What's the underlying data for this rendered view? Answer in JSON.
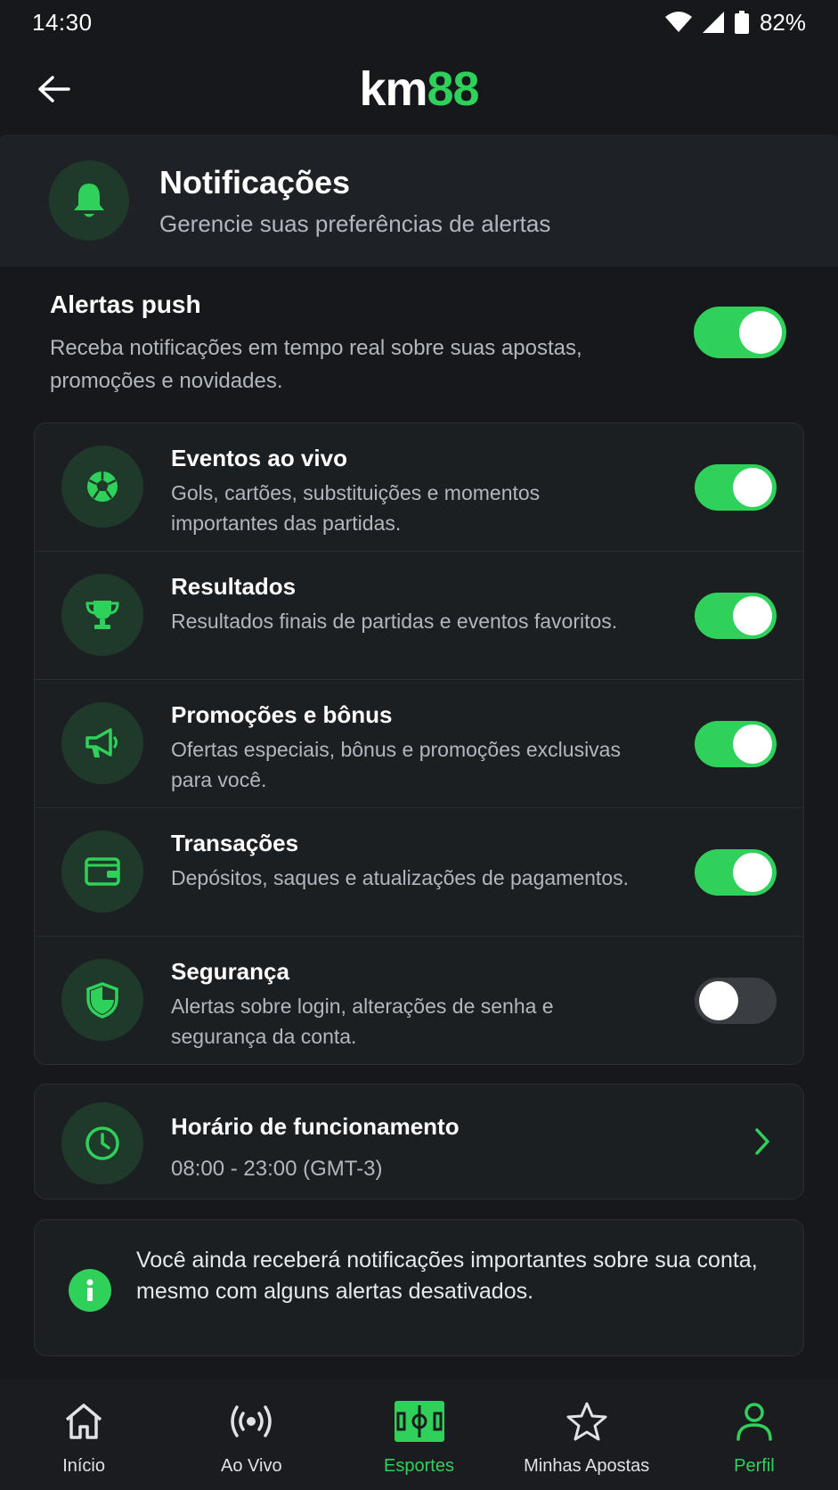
{
  "status_bar": {
    "time": "14:30",
    "battery": "82%"
  },
  "top_bar": {
    "logo_prefix": "km",
    "logo_suffix": "88"
  },
  "header": {
    "title": "Notificações",
    "subtitle": "Gerencie suas preferências de alertas"
  },
  "push": {
    "title": "Alertas push",
    "description": "Receba notificações em tempo real sobre suas apostas, promoções e novidades.",
    "enabled": true
  },
  "items": [
    {
      "title": "Eventos ao vivo",
      "description": "Gols, cartões, substituições e momentos importantes das partidas.",
      "enabled": true,
      "icon": "soccer-ball-icon"
    },
    {
      "title": "Resultados",
      "description": "Resultados finais de partidas e eventos favoritos.",
      "enabled": true,
      "icon": "trophy-icon"
    },
    {
      "title": "Promoções e bônus",
      "description": "Ofertas especiais, bônus e promoções exclusivas para você.",
      "enabled": true,
      "icon": "megaphone-icon"
    },
    {
      "title": "Transações",
      "description": "Depósitos, saques e atualizações de pagamentos.",
      "enabled": true,
      "icon": "wallet-icon"
    },
    {
      "title": "Segurança",
      "description": "Alertas sobre login, alterações de senha e segurança da conta.",
      "enabled": false,
      "icon": "shield-icon"
    }
  ],
  "schedule": {
    "title": "Horário de funcionamento",
    "time": "08:00 - 23:00 (GMT-3)"
  },
  "info": {
    "text": "Você ainda receberá notificações importantes sobre sua conta, mesmo com alguns alertas desativados."
  },
  "nav": [
    {
      "label": "Início",
      "icon": "home-icon"
    },
    {
      "label": "Ao Vivo",
      "icon": "live-icon"
    },
    {
      "label": "Esportes",
      "icon": "field-icon"
    },
    {
      "label": "Minhas Apostas",
      "icon": "star-icon"
    },
    {
      "label": "Perfil",
      "icon": "user-icon"
    }
  ],
  "colors": {
    "accent": "#2fd15a",
    "background": "#16181b",
    "card": "#1c1f22",
    "icon_bg": "#1f3a2a"
  }
}
